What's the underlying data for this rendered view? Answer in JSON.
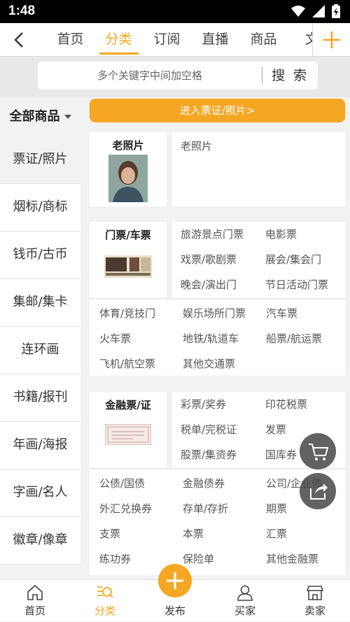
{
  "status_bar": {
    "time": "1:48"
  },
  "top_nav": {
    "tabs": [
      {
        "label": "首页"
      },
      {
        "label": "分类"
      },
      {
        "label": "订阅"
      },
      {
        "label": "直播"
      },
      {
        "label": "商品"
      },
      {
        "label": "文"
      }
    ],
    "active_tab": "分类"
  },
  "search": {
    "placeholder": "多个关键字中间加空格",
    "button": "搜 索"
  },
  "sidebar": {
    "header": "全部商品",
    "items": [
      {
        "label": "票证/照片"
      },
      {
        "label": "烟标/商标"
      },
      {
        "label": "钱币/古币"
      },
      {
        "label": "集邮/集卡"
      },
      {
        "label": "连环画"
      },
      {
        "label": "书籍/报刊"
      },
      {
        "label": "年画/海报"
      },
      {
        "label": "字画/名人"
      },
      {
        "label": "徽章/像章"
      }
    ]
  },
  "banner": {
    "label": "进入票证/照片>"
  },
  "sections": {
    "old_photos": {
      "title": "老照片",
      "links": [
        "老照片"
      ]
    },
    "tickets": {
      "title": "门票/车票",
      "links": [
        "旅游景点门票",
        "电影票",
        "戏票/歌剧票",
        "展会/集会门",
        "晚会/演出门",
        "节日活动门票",
        "体育/竞技门",
        "娱乐场所门票",
        "汽车票",
        "火车票",
        "地铁/轨道车",
        "船票/航运票",
        "飞机/航空票",
        "其他交通票"
      ]
    },
    "finance": {
      "title": "金融票/证",
      "links": [
        "彩票/奖券",
        "印花税票",
        "税单/完税证",
        "发票",
        "股票/集资券",
        "国库券",
        "公债/国债",
        "金融债券",
        "公司/企业债",
        "外汇兑换券",
        "存单/存折",
        "期票",
        "支票",
        "本票",
        "汇票",
        "练功券",
        "保险单",
        "其他金融票"
      ]
    }
  },
  "bottom_bar": {
    "items": [
      {
        "label": "首页"
      },
      {
        "label": "分类"
      },
      {
        "label": "发布"
      },
      {
        "label": "买家"
      },
      {
        "label": "卖家"
      }
    ],
    "active": "分类"
  },
  "colors": {
    "accent": "#f5a623",
    "background": "#f2f2f2",
    "text": "#333333"
  }
}
